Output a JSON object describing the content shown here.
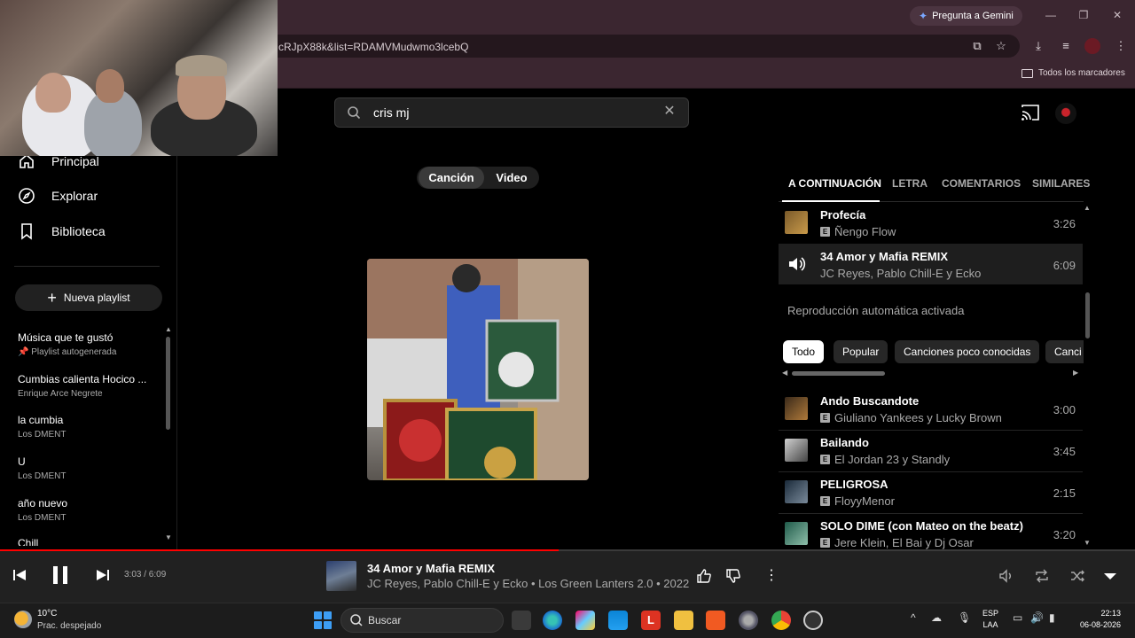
{
  "browser": {
    "gemini_label": "Pregunta a Gemini",
    "url": "cRJpX88k&list=RDAMVMudwmo3lcebQ",
    "bookmarks_all": "Todos los marcadores"
  },
  "search": {
    "value": "cris mj"
  },
  "sidebar": {
    "nav": [
      {
        "label": "Principal",
        "icon": "home-icon"
      },
      {
        "label": "Explorar",
        "icon": "compass-icon"
      },
      {
        "label": "Biblioteca",
        "icon": "library-icon"
      }
    ],
    "new_playlist": "Nueva playlist",
    "playlists": [
      {
        "title": "Música que te gustó",
        "subtitle": "Playlist autogenerada"
      },
      {
        "title": "Cumbias calienta Hocico ...",
        "subtitle": "Enrique Arce Negrete"
      },
      {
        "title": "la cumbia",
        "subtitle": "Los DMENT"
      },
      {
        "title": "U",
        "subtitle": "Los DMENT"
      },
      {
        "title": "año nuevo",
        "subtitle": "Los DMENT"
      },
      {
        "title": "Chill",
        "subtitle": ""
      }
    ]
  },
  "mode_toggle": {
    "song": "Canción",
    "video": "Video"
  },
  "tabs": [
    "A CONTINUACIÓN",
    "LETRA",
    "COMENTARIOS",
    "SIMILARES"
  ],
  "queue": [
    {
      "title": "Profecía",
      "artist": "Ñengo Flow",
      "duration": "3:26",
      "explicit": true
    },
    {
      "title": "34 Amor y Mafia REMIX",
      "artist": "JC Reyes, Pablo Chill-E y Ecko",
      "duration": "6:09",
      "explicit": false,
      "playing": true
    }
  ],
  "autoplay_label": "Reproducción automática activada",
  "chips": [
    "Todo",
    "Popular",
    "Canciones poco conocidas",
    "Canci"
  ],
  "suggestions": [
    {
      "title": "Ando Buscandote",
      "artist": "Giuliano Yankees y Lucky Brown",
      "duration": "3:00"
    },
    {
      "title": "Bailando",
      "artist": "El Jordan 23 y Standly",
      "duration": "3:45"
    },
    {
      "title": "PELIGROSA",
      "artist": "FloyyMenor",
      "duration": "2:15"
    },
    {
      "title": "SOLO DIME (con Mateo on the beatz)",
      "artist": "Jere Klein, El Bai y Dj Osar",
      "duration": "3:20"
    }
  ],
  "player": {
    "time": "3:03 / 6:09",
    "progress": 0.492,
    "title": "34 Amor y Mafia REMIX",
    "subtitle": "JC Reyes, Pablo Chill-E y Ecko • Los Green Lanters 2.0 • 2022"
  },
  "taskbar": {
    "temp": "10°C",
    "weather": "Prac. despejado",
    "search": "Buscar",
    "lang_1": "ESP",
    "lang_2": "LAA",
    "time": "22:13",
    "date": "06-08-2026"
  },
  "colors": {
    "accent_red": "#ff0000",
    "chrome": "#3b2630",
    "player_bg": "#212121"
  }
}
